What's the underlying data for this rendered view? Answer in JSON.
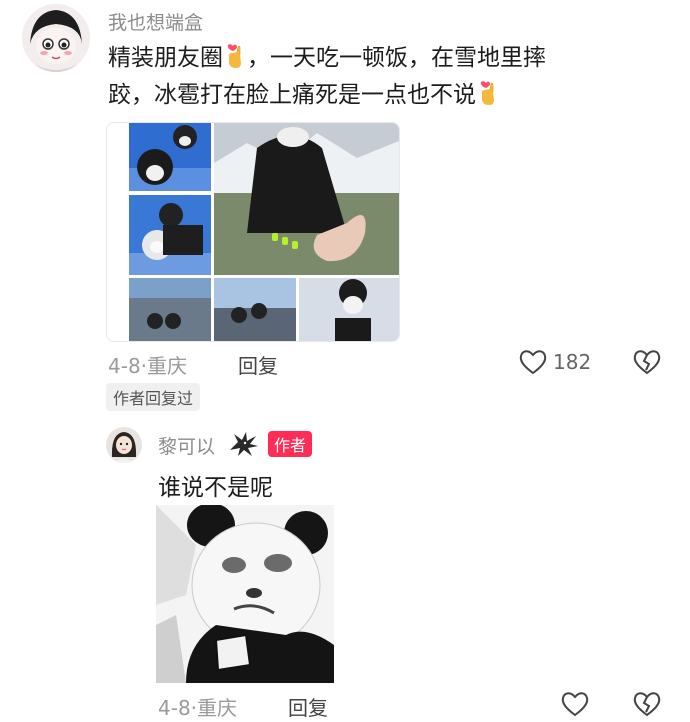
{
  "comment": {
    "username": "我也想端盒",
    "text_line1_a": "精装朋友圈",
    "text_line1_b": "，一天吃一顿饭，在雪地里摔",
    "text_line2": "跤，冰雹打在脸上痛死是一点也不说",
    "date_location": "4-8·重庆",
    "reply_label": "回复",
    "like_count": "182",
    "author_replied_tag": "作者回复过"
  },
  "reply": {
    "username": "黎可以",
    "author_badge": "作者",
    "text": "谁说不是呢",
    "date_location": "4-8·重庆",
    "reply_label": "回复"
  },
  "colors": {
    "badge_red": "#ff2d55",
    "muted_text": "#9a9a9a",
    "main_text": "#1c1c1c"
  },
  "icons": [
    "heart-outline-icon",
    "broken-heart-icon",
    "finger-heart-emoji",
    "eagle-icon"
  ]
}
